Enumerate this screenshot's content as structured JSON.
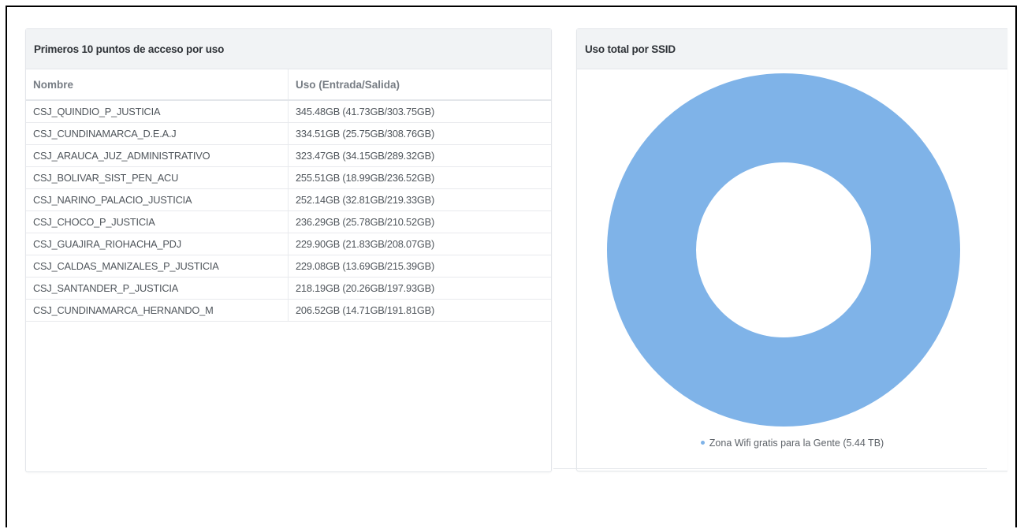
{
  "left_panel": {
    "title": "Primeros 10 puntos de acceso por uso",
    "columns": [
      "Nombre",
      "Uso (Entrada/Salida)"
    ],
    "rows": [
      [
        "CSJ_QUINDIO_P_JUSTICIA",
        "345.48GB (41.73GB/303.75GB)"
      ],
      [
        "CSJ_CUNDINAMARCA_D.E.A.J",
        "334.51GB (25.75GB/308.76GB)"
      ],
      [
        "CSJ_ARAUCA_JUZ_ADMINISTRATIVO",
        "323.47GB (34.15GB/289.32GB)"
      ],
      [
        "CSJ_BOLIVAR_SIST_PEN_ACU",
        "255.51GB (18.99GB/236.52GB)"
      ],
      [
        "CSJ_NARINO_PALACIO_JUSTICIA",
        "252.14GB (32.81GB/219.33GB)"
      ],
      [
        "CSJ_CHOCO_P_JUSTICIA",
        "236.29GB (25.78GB/210.52GB)"
      ],
      [
        "CSJ_GUAJIRA_RIOHACHA_PDJ",
        "229.90GB (21.83GB/208.07GB)"
      ],
      [
        "CSJ_CALDAS_MANIZALES_P_JUSTICIA",
        "229.08GB (13.69GB/215.39GB)"
      ],
      [
        "CSJ_SANTANDER_P_JUSTICIA",
        "218.19GB (20.26GB/197.93GB)"
      ],
      [
        "CSJ_CUNDINAMARCA_HERNANDO_M",
        "206.52GB (14.71GB/191.81GB)"
      ]
    ]
  },
  "right_panel": {
    "title": "Uso total por SSID"
  },
  "chart_data": {
    "type": "pie",
    "donut": true,
    "title": "Uso total por SSID",
    "categories": [
      "Zona Wifi gratis para la Gente"
    ],
    "values": [
      5.44
    ],
    "unit": "TB",
    "legend": [
      "Zona Wifi gratis para la Gente (5.44 TB)"
    ],
    "legend_position": "bottom",
    "colors": [
      "#7fb3e8"
    ]
  }
}
